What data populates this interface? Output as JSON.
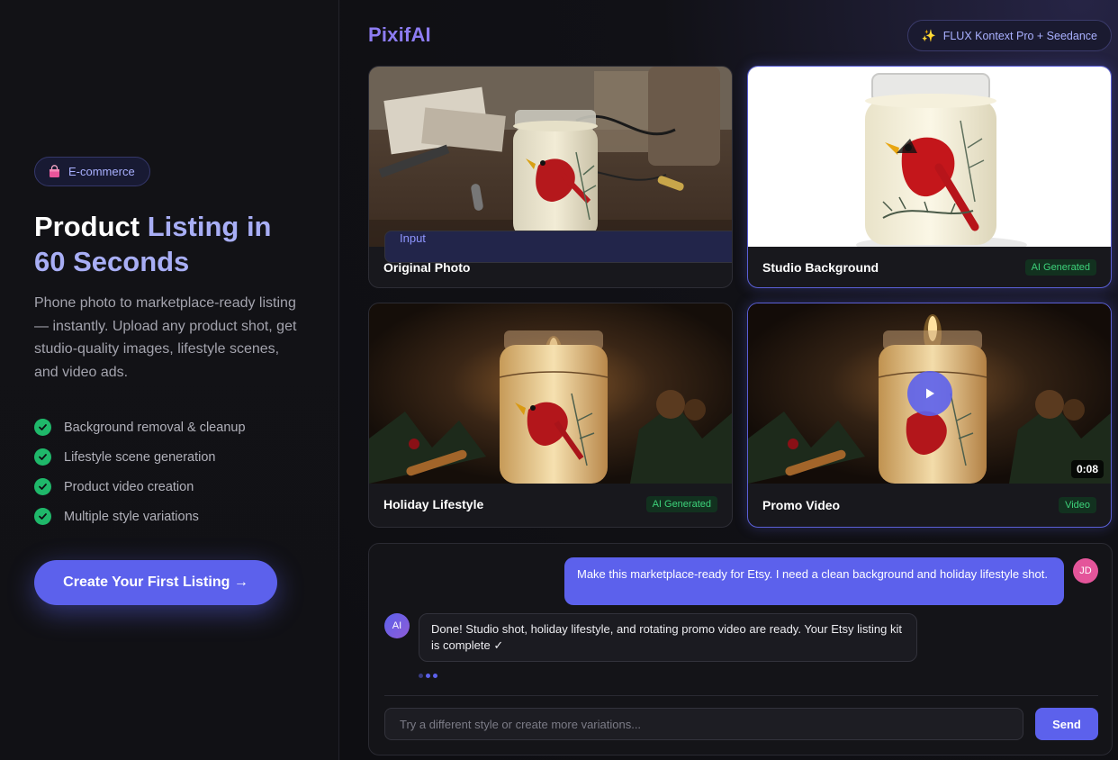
{
  "left": {
    "badge": {
      "icon": "shopping-bag-icon",
      "label": "E-commerce"
    },
    "title_line1_a": "Product ",
    "title_line1_b": "Listing in",
    "title_line2": "60 Seconds",
    "description": "Phone photo to marketplace-ready listing — instantly. Upload any product shot, get studio-quality images, lifestyle scenes, and video ads.",
    "features": [
      "Background removal & cleanup",
      "Lifestyle scene generation",
      "Product video creation",
      "Multiple style variations"
    ],
    "cta_label": "Create Your First Listing →"
  },
  "header": {
    "logo": "PixifAI",
    "model_pill": "FLUX Kontext Pro + Seedance"
  },
  "cards": [
    {
      "title": "Original Photo",
      "tag": "Input"
    },
    {
      "title": "Studio Background",
      "tag": "AI Generated"
    },
    {
      "title": "Holiday Lifestyle",
      "tag": "AI Generated"
    },
    {
      "title": "Promo Video",
      "tag": "Video",
      "duration": "0:08"
    }
  ],
  "chat": {
    "user_avatar": "JD",
    "user_message": "Make this marketplace-ready for Etsy. I need a clean background and holiday lifestyle shot.",
    "ai_avatar": "AI",
    "ai_message": "Done! Studio shot, holiday lifestyle, and rotating promo video are ready. Your Etsy listing kit is complete ✓",
    "input_placeholder": "Try a different style or create more variations...",
    "send_label": "Send"
  },
  "colors": {
    "accent": "#5c61ec",
    "success": "#1fb86a",
    "logo": "#8d7cf2"
  }
}
